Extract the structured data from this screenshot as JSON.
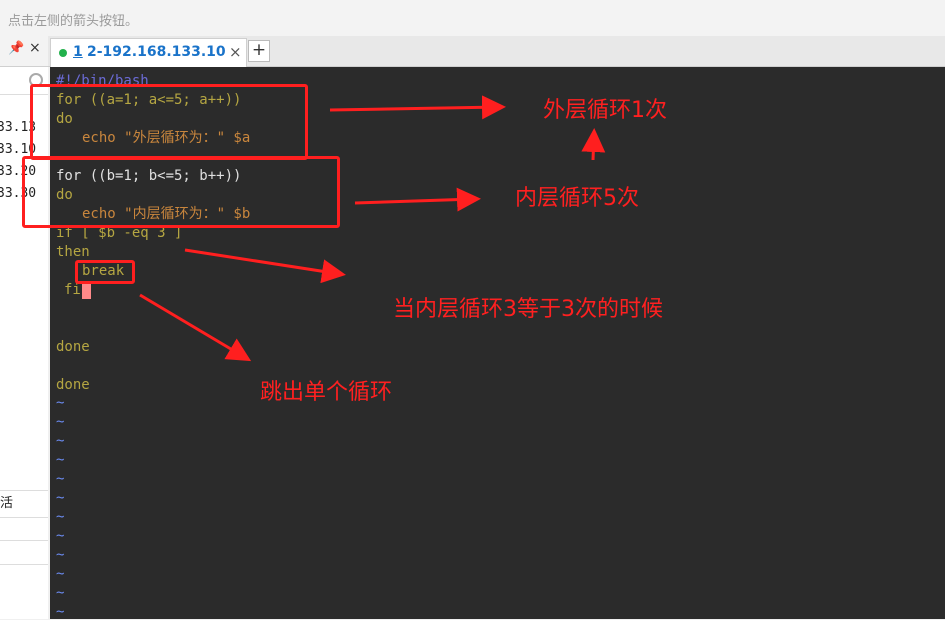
{
  "hint": "点击左侧的箭头按钮。",
  "left_panel": {
    "pin_icon": "pin-icon",
    "close": "×",
    "sessions": [
      "33.13",
      "33.10",
      "33.20",
      "33.30"
    ],
    "label": "活"
  },
  "tab": {
    "number": "1",
    "title": "2-192.168.133.10",
    "close": "×",
    "new_tab": "+"
  },
  "code": {
    "shebang": "#!/bin/bash",
    "for_outer": "for ((a=1; a<=5; a++))",
    "do1": "do",
    "echo_outer": "echo \"外层循环为：\" $a",
    "for_inner": "for ((b=1; b<=5; b++))",
    "do2": "do",
    "echo_inner": "echo \"内层循环为：\" $b",
    "if": "if [ $b -eq 3 ]",
    "then": "then",
    "break": "break",
    "fi": "fi",
    "done1": "done",
    "done2": "done",
    "tilde": "~"
  },
  "annotations": {
    "outer": "外层循环1次",
    "inner": "内层循环5次",
    "when": "当内层循环3等于3次的时候",
    "exit": "跳出单个循环"
  },
  "colors": {
    "arrow": "#ff1f1f",
    "terminal_bg": "#2b2b2b",
    "keyword": "#b5a642",
    "string": "#c9863d",
    "var": "#9b8cc7"
  }
}
